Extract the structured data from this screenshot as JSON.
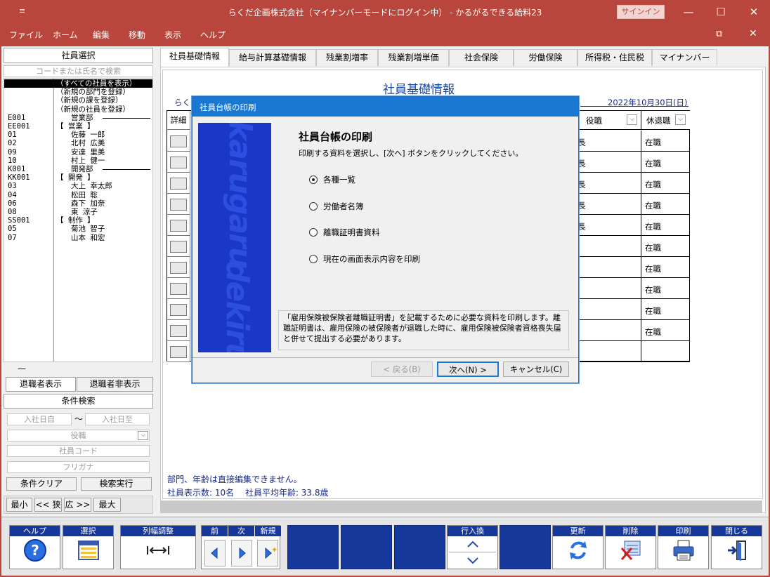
{
  "window": {
    "title": "らくだ企画株式会社（マイナンバーモードにログイン中） - かるがるできる給料23",
    "signin": "サインイン",
    "app_icon": "≡",
    "minimize": "—",
    "maximize": "☐",
    "close": "✕",
    "restore": "⧉",
    "close2": "✕"
  },
  "menu": [
    "ファイル",
    "ホーム",
    "編集",
    "移動",
    "表示",
    "ヘルプ"
  ],
  "left_panel": {
    "header": "社員選択",
    "search_placeholder": "コードまたは氏名で検索",
    "rows": [
      {
        "code": "",
        "name": "（すべての社員を表示）",
        "sel": true
      },
      {
        "code": "",
        "name": "（新規の部門を登録）"
      },
      {
        "code": "",
        "name": "（新規の課を登録）"
      },
      {
        "code": "",
        "name": "（新規の社員を登録）"
      },
      {
        "code": "E001",
        "name": "　　営業部",
        "line": true
      },
      {
        "code": "EE001",
        "name": "【 営業 】"
      },
      {
        "code": "01",
        "name": "　　佐藤 一郎"
      },
      {
        "code": "02",
        "name": "　　北村 広美"
      },
      {
        "code": "09",
        "name": "　　安達 里美"
      },
      {
        "code": "10",
        "name": "　　村上 健一"
      },
      {
        "code": "K001",
        "name": "　　開発部",
        "line": true
      },
      {
        "code": "KK001",
        "name": "【 開発 】"
      },
      {
        "code": "03",
        "name": "　　大上 幸太郎"
      },
      {
        "code": "04",
        "name": "　　松田 聡"
      },
      {
        "code": "06",
        "name": "　　森下 加奈"
      },
      {
        "code": "08",
        "name": "　　東 涼子"
      },
      {
        "code": "SS001",
        "name": "【 制作 】"
      },
      {
        "code": "05",
        "name": "　　菊池 智子"
      },
      {
        "code": "07",
        "name": "　　山本 和宏"
      }
    ],
    "dash": "—",
    "show_retired": "退職者表示",
    "hide_retired": "退職者非表示",
    "cond_search": "条件検索",
    "join_from": "入社日自",
    "tilde": "〜",
    "join_to": "入社日至",
    "position": "役職",
    "emp_code": "社員コード",
    "furigana": "フリガナ",
    "clear": "条件クリア",
    "run": "検索実行",
    "min": "最小",
    "narrow": "<< 狭",
    "wide": "広 >>",
    "max": "最大"
  },
  "tabs": [
    "社員基礎情報",
    "給与計算基礎情報",
    "残業割増率",
    "残業割増単価",
    "社会保険",
    "労働保険",
    "所得税・住民税",
    "マイナンバー"
  ],
  "content": {
    "heading": "社員基礎情報",
    "company_fragment": "らく",
    "date": "2022年10月30日(日)",
    "detail_header": "詳細",
    "col_position": "役職",
    "col_status": "休退職",
    "rows": [
      {
        "pos": "長",
        "status": "在職"
      },
      {
        "pos": "長",
        "status": "在職"
      },
      {
        "pos": "長",
        "status": "在職"
      },
      {
        "pos": "長",
        "status": "在職"
      },
      {
        "pos": "長",
        "status": "在職"
      },
      {
        "pos": "",
        "status": "在職"
      },
      {
        "pos": "",
        "status": "在職"
      },
      {
        "pos": "",
        "status": "在職"
      },
      {
        "pos": "",
        "status": "在職"
      },
      {
        "pos": "",
        "status": "在職"
      },
      {
        "pos": "",
        "status": ""
      }
    ],
    "note": "部門、年齢は直接編集できません。",
    "summary": "社員表示数: 10名　 社員平均年齢: 33.8歳"
  },
  "toolbar": {
    "help": "ヘルプ",
    "select": "選択",
    "colwidth": "列幅調整",
    "prev": "前",
    "next": "次",
    "new": "新規",
    "swap": "行入換",
    "update": "更新",
    "delete": "削除",
    "print": "印刷",
    "close": "閉じる"
  },
  "dialog": {
    "title": "社員台帳の印刷",
    "banner_top": "karugaru",
    "banner_bottom": "dekiru",
    "heading": "社員台帳の印刷",
    "instruction": "印刷する資料を選択し、[次へ] ボタンをクリックしてください。",
    "options": [
      "各種一覧",
      "労働者名簿",
      "離職証明書資料",
      "現在の画面表示内容を印刷"
    ],
    "selected": 0,
    "description": "「雇用保険被保険者離職証明書」を記載するために必要な資料を印刷します。離職証明書は、雇用保険の被保険者が退職した時に、雇用保険被保険者資格喪失届と併せて提出する必要があります。",
    "back": "< 戻る(B)",
    "next": "次へ(N) >",
    "cancel": "キャンセル(C)"
  }
}
